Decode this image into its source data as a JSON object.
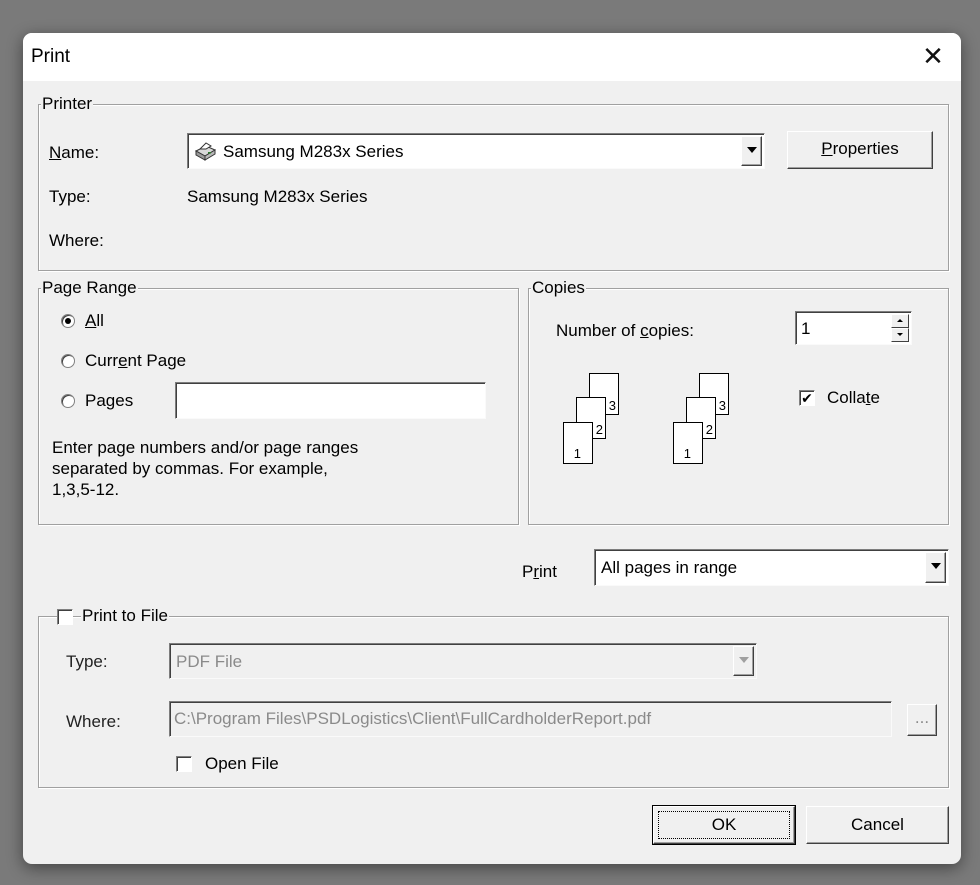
{
  "dialog": {
    "title": "Print"
  },
  "printer": {
    "legend": "Printer",
    "name_label_prefix": "",
    "name_label_ul": "N",
    "name_label_rest": "ame:",
    "name_value": "Samsung M283x Series",
    "properties_ul": "P",
    "properties_rest": "roperties",
    "type_label": "Type:",
    "type_value": "Samsung M283x Series",
    "where_label": "Where:"
  },
  "page_range": {
    "legend": "Page Range",
    "all_ul": "A",
    "all_rest": "ll",
    "current_pre": "Curr",
    "current_ul": "e",
    "current_post": "nt Page",
    "pages_pre": "Pa",
    "pages_ul": "g",
    "pages_post": "es",
    "pages_value": "",
    "hint_line1": "Enter page numbers and/or page ranges",
    "hint_line2": "separated by commas.  For example,",
    "hint_line3": "1,3,5-12.",
    "selected": "All"
  },
  "copies": {
    "legend": "Copies",
    "count_label_pre": "Number of ",
    "count_label_ul": "c",
    "count_label_post": "opies:",
    "count_value": "1",
    "collate_pre": "Colla",
    "collate_ul": "t",
    "collate_post": "e",
    "collate_checked": true,
    "collate_check": "✔",
    "illus_pages": [
      "1",
      "2",
      "3"
    ]
  },
  "print_what": {
    "label_pre": "P",
    "label_ul": "r",
    "label_post": "int",
    "value": "All pages in range"
  },
  "print_to_file": {
    "legend": "Print to File",
    "checked": false,
    "type_label": "Type:",
    "type_value": "PDF File",
    "where_label": "Where:",
    "where_value": "C:\\Program Files\\PSDLogistics\\Client\\FullCardholderReport.pdf",
    "browse_label": "...",
    "open_file_label": "Open File",
    "open_file_checked": false
  },
  "buttons": {
    "ok": "OK",
    "cancel": "Cancel"
  }
}
